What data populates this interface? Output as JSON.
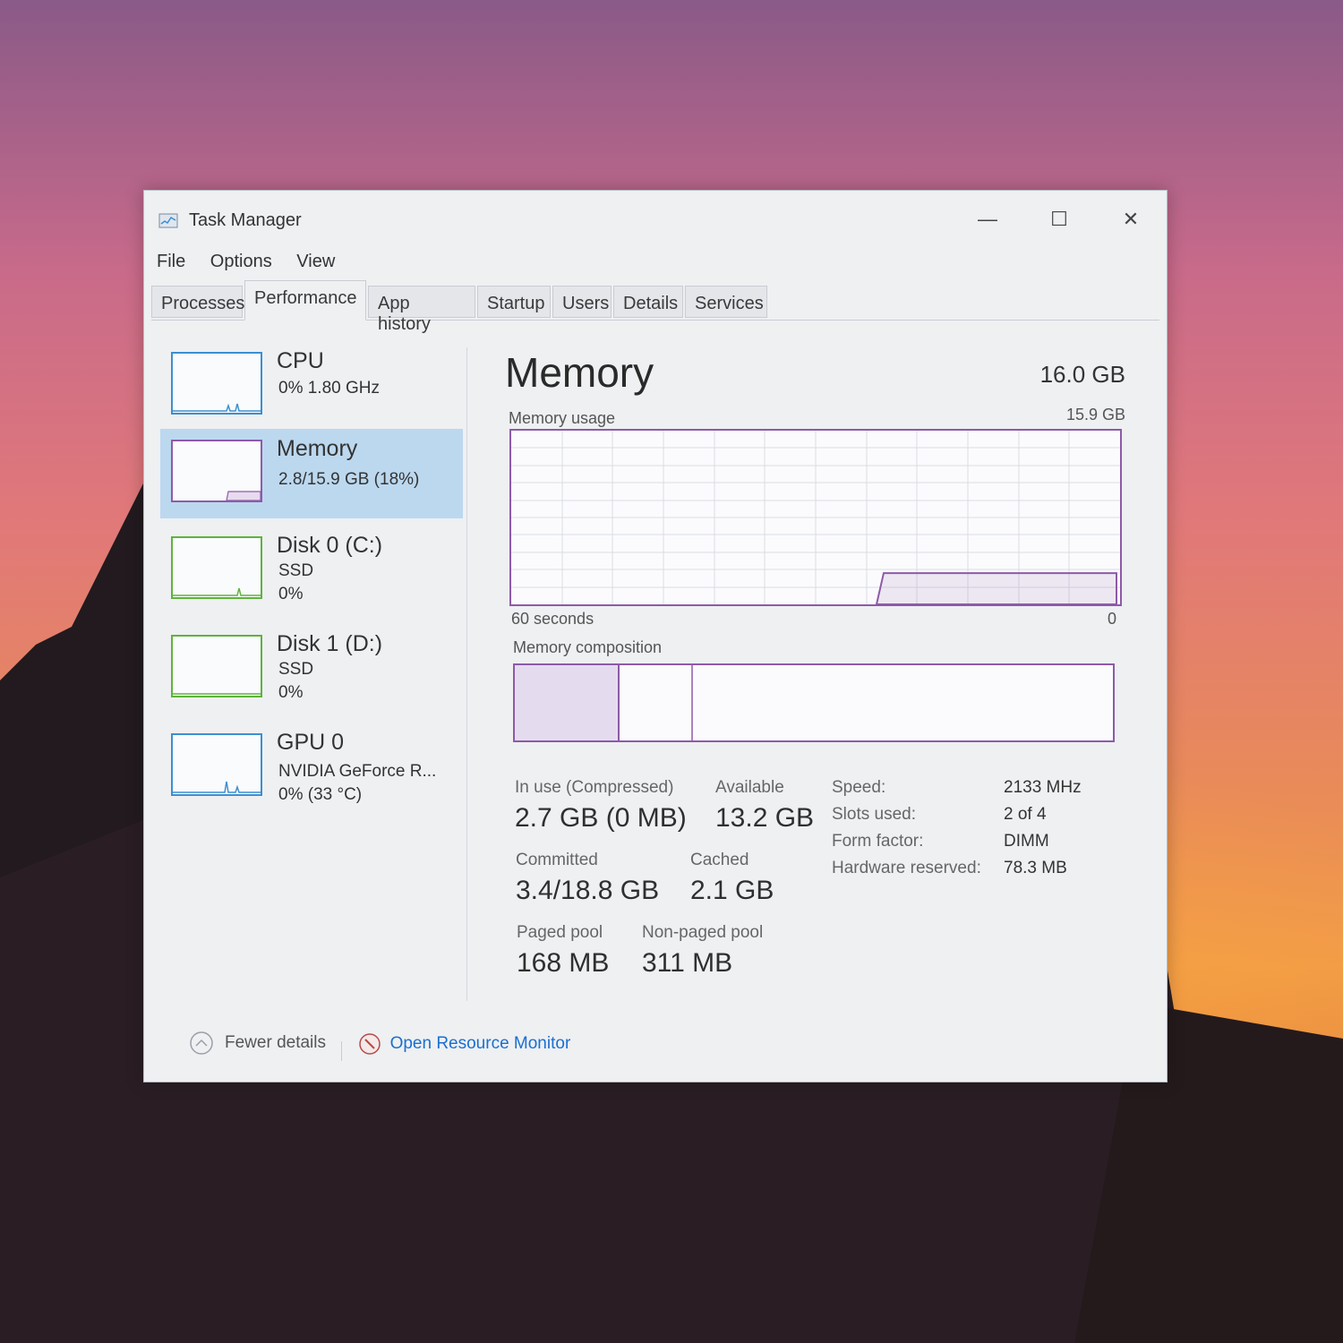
{
  "window": {
    "title": "Task Manager",
    "controls": {
      "minimize": "—",
      "maximize": "☐",
      "close": "✕"
    }
  },
  "menu": [
    "File",
    "Options",
    "View"
  ],
  "tabs": [
    "Processes",
    "Performance",
    "App history",
    "Startup",
    "Users",
    "Details",
    "Services"
  ],
  "active_tab": "Performance",
  "sidebar": [
    {
      "title": "CPU",
      "line1": "0% 1.80 GHz",
      "line2": "",
      "color": "#3c8fd0"
    },
    {
      "title": "Memory",
      "line1": "2.8/15.9 GB (18%)",
      "line2": "",
      "color": "#8e5aa8"
    },
    {
      "title": "Disk 0 (C:)",
      "line1": "SSD",
      "line2": "0%",
      "color": "#5fb33c"
    },
    {
      "title": "Disk 1 (D:)",
      "line1": "SSD",
      "line2": "0%",
      "color": "#5fb33c"
    },
    {
      "title": "GPU 0",
      "line1": "NVIDIA GeForce R...",
      "line2": "0% (33 °C)",
      "color": "#3c8fd0"
    }
  ],
  "memory": {
    "title": "Memory",
    "total": "16.0 GB",
    "usage_label": "Memory usage",
    "usage_max": "15.9 GB",
    "time_left": "60 seconds",
    "time_right": "0",
    "composition_label": "Memory composition",
    "in_use_label": "In use (Compressed)",
    "in_use_value": "2.7 GB (0 MB)",
    "available_label": "Available",
    "available_value": "13.2 GB",
    "committed_label": "Committed",
    "committed_value": "3.4/18.8 GB",
    "cached_label": "Cached",
    "cached_value": "2.1 GB",
    "paged_label": "Paged pool",
    "paged_value": "168 MB",
    "nonpaged_label": "Non-paged pool",
    "nonpaged_value": "311 MB",
    "details": [
      {
        "key": "Speed:",
        "value": "2133 MHz"
      },
      {
        "key": "Slots used:",
        "value": "2 of 4"
      },
      {
        "key": "Form factor:",
        "value": "DIMM"
      },
      {
        "key": "Hardware reserved:",
        "value": "78.3 MB"
      }
    ],
    "usage_fraction": 0.18
  },
  "footer": {
    "fewer_details": "Fewer details",
    "resource_monitor": "Open Resource Monitor"
  }
}
